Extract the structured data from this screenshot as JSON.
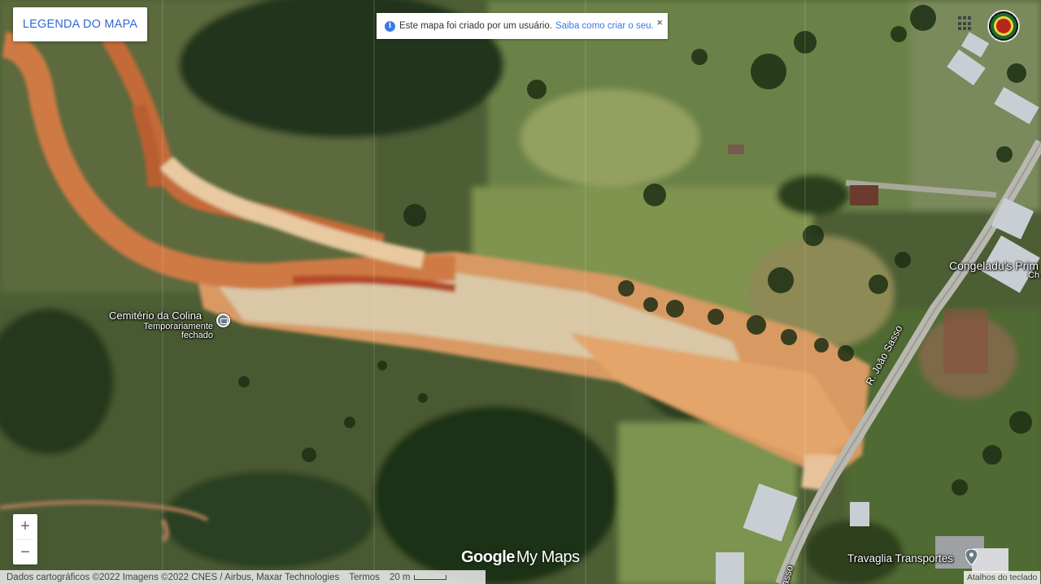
{
  "legend_button": "LEGENDA DO MAPA",
  "notice": {
    "text": "Este mapa foi criado por um usuário.",
    "link": "Saiba como criar o seu.",
    "close": "×"
  },
  "labels": {
    "cemetery_name": "Cemitério da Colina",
    "cemetery_status_line1": "Temporariamente",
    "cemetery_status_line2": "fechado",
    "congelados": "Congeladu's Prim",
    "congelados_sub": "Ch",
    "street": "R. João Sasso",
    "street_bottom": "asso",
    "travaglia": "Travaglia Transportes"
  },
  "zoom": {
    "in": "+",
    "out": "−"
  },
  "logo": {
    "google": "Google",
    "mymaps": "My Maps"
  },
  "footer": {
    "attribution": "Dados cartográficos ©2022 Imagens ©2022 CNES / Airbus, Maxar Technologies",
    "terms": "Termos",
    "scale": "20 m"
  },
  "shortcuts": "Atalhos do teclado",
  "icons": {
    "info": "info-icon",
    "close": "close-icon",
    "apps": "apps-grid-icon",
    "camera_poi": "camera-icon",
    "pin": "map-pin-icon"
  },
  "colors": {
    "link_blue": "#3b78e7",
    "legend_blue": "#3367d6"
  }
}
